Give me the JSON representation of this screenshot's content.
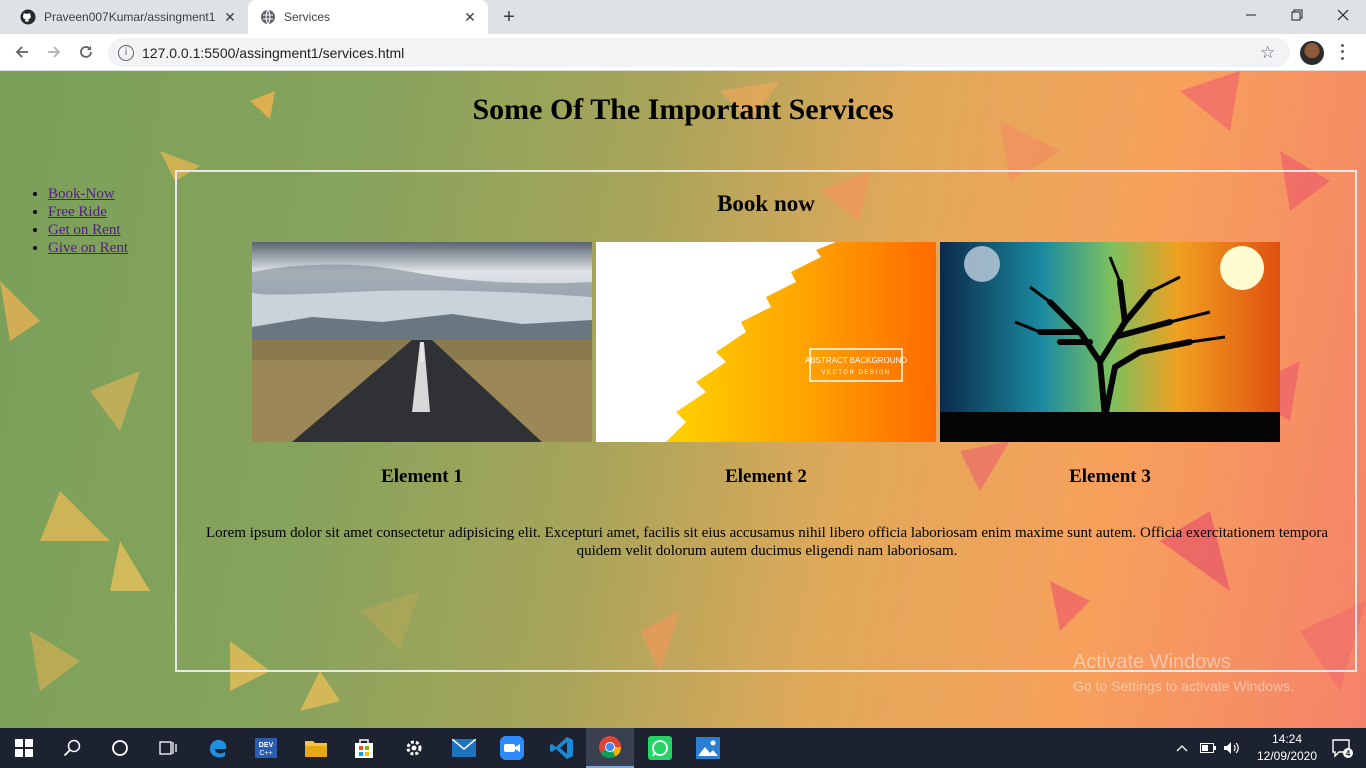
{
  "browser": {
    "tabs": [
      {
        "title": "Praveen007Kumar/assingment1",
        "favicon": "github-icon",
        "active": false
      },
      {
        "title": "Services",
        "favicon": "globe-icon",
        "active": true
      }
    ],
    "url": "127.0.0.1:5500/assingment1/services.html"
  },
  "page": {
    "title": "Some Of The Important Services",
    "nav": [
      "Book-Now",
      "Free Ride",
      "Get on Rent",
      "Give on Rent"
    ],
    "section_title": "Book now",
    "cards": [
      {
        "label": "Element 1",
        "image": "road-landscape-image"
      },
      {
        "label": "Element 2",
        "image": "abstract-orange-background-image",
        "image_text_1": "ABSTRACT BACKGROUND",
        "image_text_2": "VECTOR DESIGN"
      },
      {
        "label": "Element 3",
        "image": "tree-night-sun-image"
      }
    ],
    "paragraph": "Lorem ipsum dolor sit amet consectetur adipisicing elit. Excepturi amet, facilis sit eius accusamus nihil libero officia laboriosam enim maxime sunt autem. Officia exercitationem tempora quidem velit dolorum autem ducimus eligendi nam laboriosam."
  },
  "watermark": {
    "line1": "Activate Windows",
    "line2": "Go to Settings to activate Windows."
  },
  "taskbar": {
    "time": "14:24",
    "date": "12/09/2020",
    "notification_count": "4",
    "apps": [
      "windows-start-icon",
      "search-icon",
      "cortana-icon",
      "task-view-icon",
      "edge-icon",
      "devcpp-icon",
      "file-explorer-icon",
      "store-icon",
      "settings-icon",
      "mail-icon",
      "zoom-icon",
      "vscode-icon",
      "chrome-icon",
      "whatsapp-icon",
      "photos-icon"
    ]
  },
  "colors": {
    "link": "#551a8b",
    "taskbar": "#1c2230"
  }
}
